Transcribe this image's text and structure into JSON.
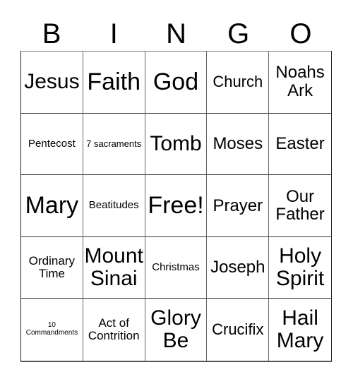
{
  "header": [
    "B",
    "I",
    "N",
    "G",
    "O"
  ],
  "cells": [
    {
      "text": "Jesus",
      "size": "l"
    },
    {
      "text": "Faith",
      "size": "xl"
    },
    {
      "text": "God",
      "size": "xl"
    },
    {
      "text": "Church",
      "size": "ms"
    },
    {
      "text": "Noahs Ark",
      "size": "m"
    },
    {
      "text": "Pentecost",
      "size": "xs"
    },
    {
      "text": "7 sacraments",
      "size": "xxs"
    },
    {
      "text": "Tomb",
      "size": "l"
    },
    {
      "text": "Moses",
      "size": "m"
    },
    {
      "text": "Easter",
      "size": "m"
    },
    {
      "text": "Mary",
      "size": "xl"
    },
    {
      "text": "Beatitudes",
      "size": "xs"
    },
    {
      "text": "Free!",
      "size": "xl"
    },
    {
      "text": "Prayer",
      "size": "m"
    },
    {
      "text": "Our Father",
      "size": "m"
    },
    {
      "text": "Ordinary Time",
      "size": "s"
    },
    {
      "text": "Mount Sinai",
      "size": "l"
    },
    {
      "text": "Christmas",
      "size": "xs"
    },
    {
      "text": "Joseph",
      "size": "m"
    },
    {
      "text": "Holy Spirit",
      "size": "l"
    },
    {
      "text": "10 Commandments",
      "size": "tiny"
    },
    {
      "text": "Act of Contrition",
      "size": "s"
    },
    {
      "text": "Glory Be",
      "size": "l"
    },
    {
      "text": "Crucifix",
      "size": "ms"
    },
    {
      "text": "Hail Mary",
      "size": "l"
    }
  ]
}
